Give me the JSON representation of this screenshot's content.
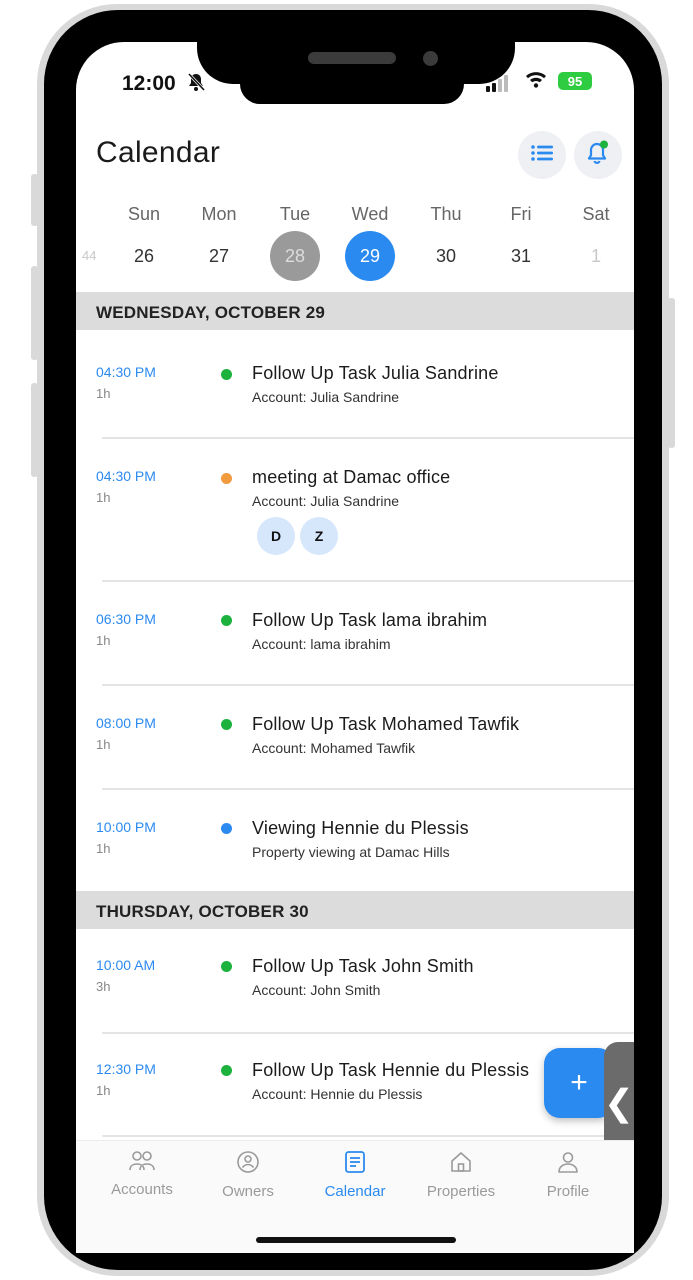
{
  "status_bar": {
    "time": "12:00",
    "battery": "95"
  },
  "header": {
    "title": "Calendar"
  },
  "week": {
    "days": [
      {
        "name": "Sun",
        "date": "26"
      },
      {
        "name": "Mon",
        "date": "27"
      },
      {
        "name": "Tue",
        "date": "28"
      },
      {
        "name": "Wed",
        "date": "29"
      },
      {
        "name": "Thu",
        "date": "30"
      },
      {
        "name": "Fri",
        "date": "31"
      },
      {
        "name": "Sat",
        "date": "1"
      }
    ],
    "prev_edge": "44"
  },
  "sections": [
    {
      "label": "WEDNESDAY, OCTOBER 29",
      "events": [
        {
          "time": "04:30 PM",
          "duration": "1h",
          "title": "Follow Up Task Julia Sandrine",
          "subtitle": "Account: Julia Sandrine",
          "dot_color": "#1db23d"
        },
        {
          "time": "04:30 PM",
          "duration": "1h",
          "title": "meeting at Damac office",
          "subtitle": "Account: Julia Sandrine",
          "dot_color": "#f19a3e",
          "attendees": [
            "D",
            "Z"
          ]
        },
        {
          "time": "06:30 PM",
          "duration": "1h",
          "title": "Follow Up Task lama ibrahim",
          "subtitle": "Account: lama ibrahim",
          "dot_color": "#1db23d"
        },
        {
          "time": "08:00 PM",
          "duration": "1h",
          "title": "Follow Up Task Mohamed Tawfik",
          "subtitle": "Account: Mohamed Tawfik",
          "dot_color": "#1db23d"
        },
        {
          "time": "10:00 PM",
          "duration": "1h",
          "title": "Viewing Hennie du Plessis",
          "subtitle": "Property viewing at Damac Hills",
          "dot_color": "#2b8af0"
        }
      ]
    },
    {
      "label": "THURSDAY, OCTOBER 30",
      "events": [
        {
          "time": "10:00 AM",
          "duration": "3h",
          "title": "Follow Up Task John Smith",
          "subtitle": "Account: John Smith",
          "dot_color": "#1db23d"
        },
        {
          "time": "12:30 PM",
          "duration": "1h",
          "title": "Follow Up Task Hennie du Plessis",
          "subtitle": "Account: Hennie du Plessis",
          "dot_color": "#1db23d"
        }
      ]
    }
  ],
  "fab": {
    "label": "+"
  },
  "side_tab": {
    "label": "❮"
  },
  "nav": {
    "items": [
      {
        "label": "Accounts",
        "icon": "users-icon"
      },
      {
        "label": "Owners",
        "icon": "owner-icon"
      },
      {
        "label": "Calendar",
        "icon": "calendar-icon"
      },
      {
        "label": "Properties",
        "icon": "home-icon"
      },
      {
        "label": "Profile",
        "icon": "person-icon"
      }
    ]
  },
  "colors": {
    "accent": "#2b8af0",
    "section_bg": "#dcdcdc"
  }
}
